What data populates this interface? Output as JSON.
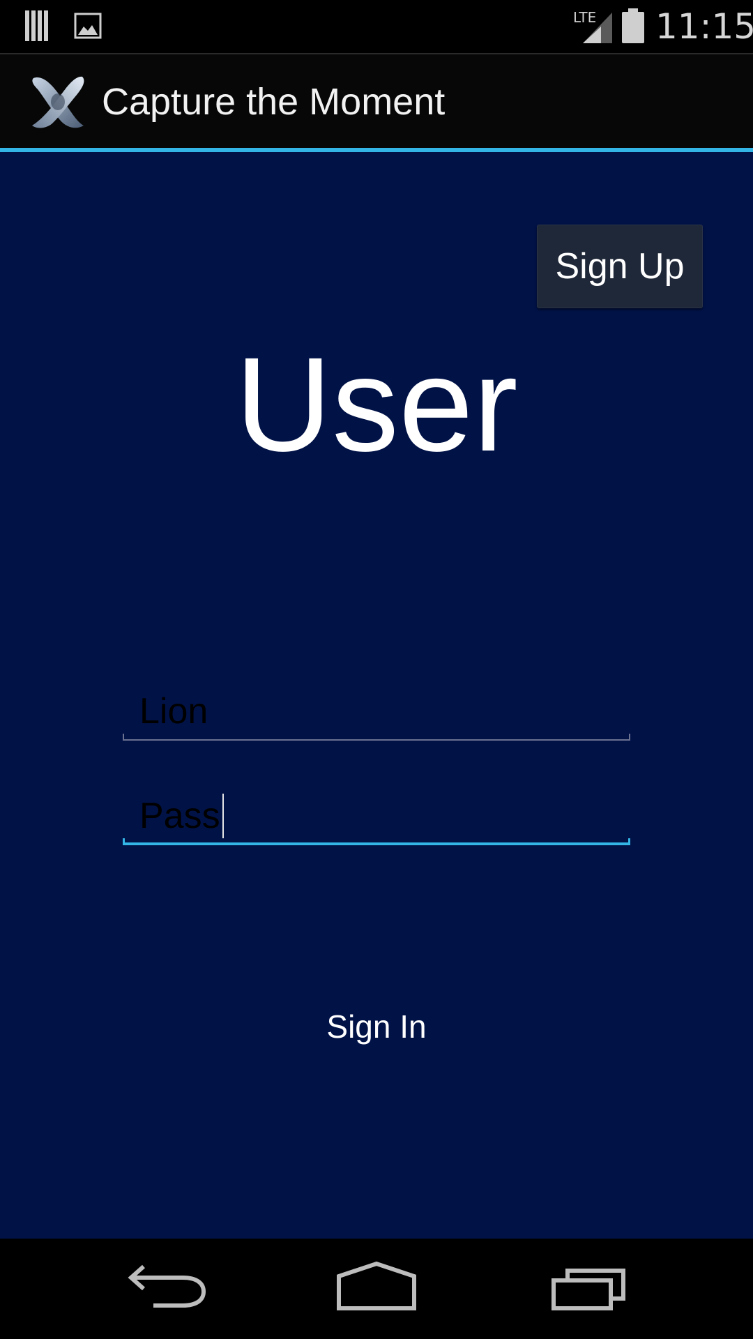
{
  "status_bar": {
    "time": "11:15",
    "network_label": "LTE",
    "icons": [
      "barcode-notification-icon",
      "image-notification-icon",
      "lte-signal-icon",
      "battery-icon"
    ]
  },
  "action_bar": {
    "title": "Capture the Moment",
    "logo": "app-logo-icon",
    "accent_color": "#33b5e5"
  },
  "main": {
    "signup_label": "Sign Up",
    "heading": "User",
    "username_value": "Lion",
    "password_value": "Pass",
    "signin_label": "Sign In",
    "background_color": "#011247"
  },
  "nav_bar": {
    "icons": [
      "back-icon",
      "home-icon",
      "recent-apps-icon"
    ]
  }
}
